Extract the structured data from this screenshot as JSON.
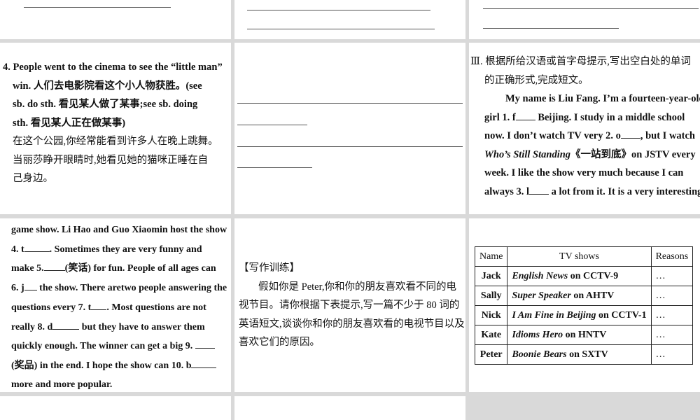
{
  "col1_p2": {
    "line1_a": "4. People went to the cinema to see the “little man”",
    "line2": "win. 人们去电影院看这个小人物获胜。(see",
    "line3": "sb. do sth. 看见某人做了某事;see sb. doing",
    "line4": "sth. 看见某人正在做某事)",
    "ex1": "在这个公园,你经常能看到许多人在晚上跳舞。",
    "ex2a": "当丽莎睁开眼睛时,她看见她的猫咪正睡在自",
    "ex2b": "己身边。"
  },
  "col3_p2": {
    "heading_1": "Ⅲ. 根据所给汉语或首字母提示,写出空白处的单词",
    "heading_2": "的正确形式,完成短文。",
    "l1": "My name is Liu Fang. I’m a fourteen-year-old",
    "l2a": "girl 1. f",
    "b1": "",
    "l2b": " Beijing. I study in a middle school",
    "l3a": "now. I don’t watch TV very 2. o",
    "b2": "",
    "l3b": ", but I watch",
    "l4a": "Who’s Still Standing",
    "l4b": "《一站到底》on JSTV every",
    "l5": "week. I like the show very much because I can",
    "l6a": "always 3. l",
    "b3": "",
    "l6b": " a lot from it. It is a very interesting"
  },
  "col1_p3": {
    "l1": "game show. Li Hao and Guo Xiaomin host the show",
    "l2a": "4. t",
    "l2b": ". Sometimes they are very funny and",
    "l3a": "make 5.",
    "l3b": "(笑话) for fun. People of all ages can",
    "l4a": "6. j",
    "l4b": " the show. There aretwo people answering the",
    "l5a": "questions every 7. t",
    "l5b": ". Most questions are not",
    "l6a": "really 8. d",
    "l6b": " but they have to answer them",
    "l7a": "quickly enough. The winner can get a big 9.",
    "l8a": "(奖品) in the end. I hope the show can 10. b",
    "l9": "more and more popular."
  },
  "col2_p3": {
    "title": "【写作训练】",
    "body1": "假如你是 Peter,你和你的朋友喜欢看不同的电",
    "body2": "视节目。请你根据下表提示,写一篇不少于 80 词的",
    "body3": "英语短文,谈谈你和你的朋友喜欢看的电视节目以及",
    "body4": "喜欢它们的原因。"
  },
  "table": {
    "headers": [
      "Name",
      "TV shows",
      "Reasons"
    ],
    "rows": [
      {
        "name": "Jack",
        "show": "English News",
        "channel": " on CCTV-9",
        "reason": "…"
      },
      {
        "name": "Sally",
        "show": "Super Speaker",
        "channel": " on AHTV",
        "reason": "…"
      },
      {
        "name": "Nick",
        "show": "I Am Fine in Beijing",
        "channel": " on CCTV-1",
        "reason": "…"
      },
      {
        "name": "Kate",
        "show": "Idioms Hero",
        "channel": " on HNTV",
        "reason": "…"
      },
      {
        "name": "Peter",
        "show": "Boonie Bears",
        "channel": " on SXTV",
        "reason": "…"
      }
    ]
  },
  "colors": {
    "background": "#d9d9d9",
    "panel": "#ffffff",
    "text": "#111111"
  }
}
